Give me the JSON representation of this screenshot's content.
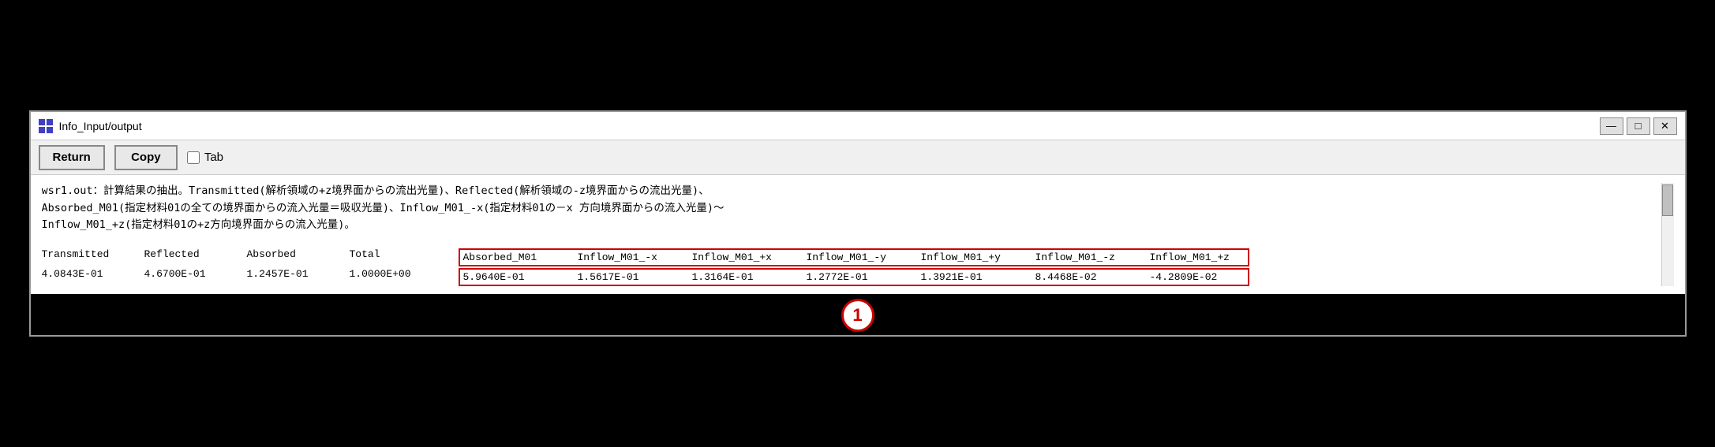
{
  "window": {
    "title": "Info_Input/output",
    "icon": "grid-icon"
  },
  "title_controls": {
    "minimize": "—",
    "maximize": "□",
    "close": "✕"
  },
  "toolbar": {
    "return_label": "Return",
    "copy_label": "Copy",
    "tab_label": "Tab",
    "tab_checked": false
  },
  "description": {
    "line1": "wsr1.out：計算結果の抽出。Transmitted(解析領域の+z境界面からの流出光量)、Reflected(解析領域の-z境界面からの流出光量)、",
    "line2": "Absorbed_M01(指定材料01の全ての境界面からの流入光量＝吸収光量)、Inflow_M01_-x(指定材料01の－x 方向境界面からの流入光量)～",
    "line3": "Inflow_M01_+z(指定材料01の+z方向境界面からの流入光量)。"
  },
  "table": {
    "headers_normal": [
      "Transmitted",
      "Reflected",
      "Absorbed",
      "Total"
    ],
    "headers_highlighted": [
      "Absorbed_M01",
      "Inflow_M01_-x",
      "Inflow_M01_+x",
      "Inflow_M01_-y",
      "Inflow_M01_+y",
      "Inflow_M01_-z",
      "Inflow_M01_+z"
    ],
    "data_normal": [
      "4.0843E-01",
      "4.6700E-01",
      "1.2457E-01",
      "1.0000E+00"
    ],
    "data_highlighted": [
      "5.9640E-01",
      "1.5617E-01",
      "1.3164E-01",
      "1.2772E-01",
      "1.3921E-01",
      "8.4468E-02",
      "-4.2809E-02"
    ]
  },
  "badge": {
    "label": "1"
  }
}
